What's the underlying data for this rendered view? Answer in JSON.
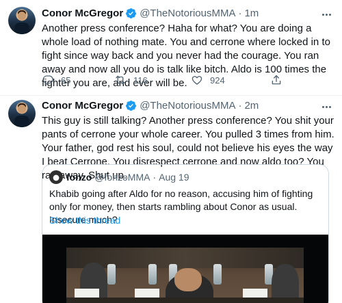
{
  "tweets": [
    {
      "author": "Conor McGregor",
      "handle": "@TheNotoriousMMA",
      "separator": "·",
      "time": "1m",
      "text": "Another press conference? Haha for what? You are doing a whole load of nothing mate. You and cerrone where locked in to fight since way back and you never had the courage. You ran away and now all you do is talk like bitch. Aldo is 100 times the fighter you are, and ever will be.",
      "replies": "65",
      "retweets": "116",
      "likes": "924"
    },
    {
      "author": "Conor McGregor",
      "handle": "@TheNotoriousMMA",
      "separator": "·",
      "time": "2m",
      "text": "This guy is still talking? Another press conference? You shit your pants of cerrone your whole career. You pulled 3 times from him. Your father, god rest his soul, could not believe his eyes the way I beat Cerrone. You disrespect cerrone and now aldo too? You ran away. Shut up.",
      "quote": {
        "author": "fonzo",
        "handle": "@fonzoMMA",
        "separator": "·",
        "time": "Aug 19",
        "text": "Khabib going after Aldo for no reason, accusing him of fighting only for money, then starts rambling about Conor as usual. Insecure much?",
        "link": "Show this thread"
      }
    }
  ],
  "colors": {
    "accent": "#1d9bf0",
    "text": "#0f1419",
    "secondary": "#536471",
    "border": "#cfd9de"
  },
  "icons": [
    "verified-badge-icon",
    "more-icon",
    "reply-icon",
    "retweet-icon",
    "like-icon",
    "share-icon"
  ]
}
